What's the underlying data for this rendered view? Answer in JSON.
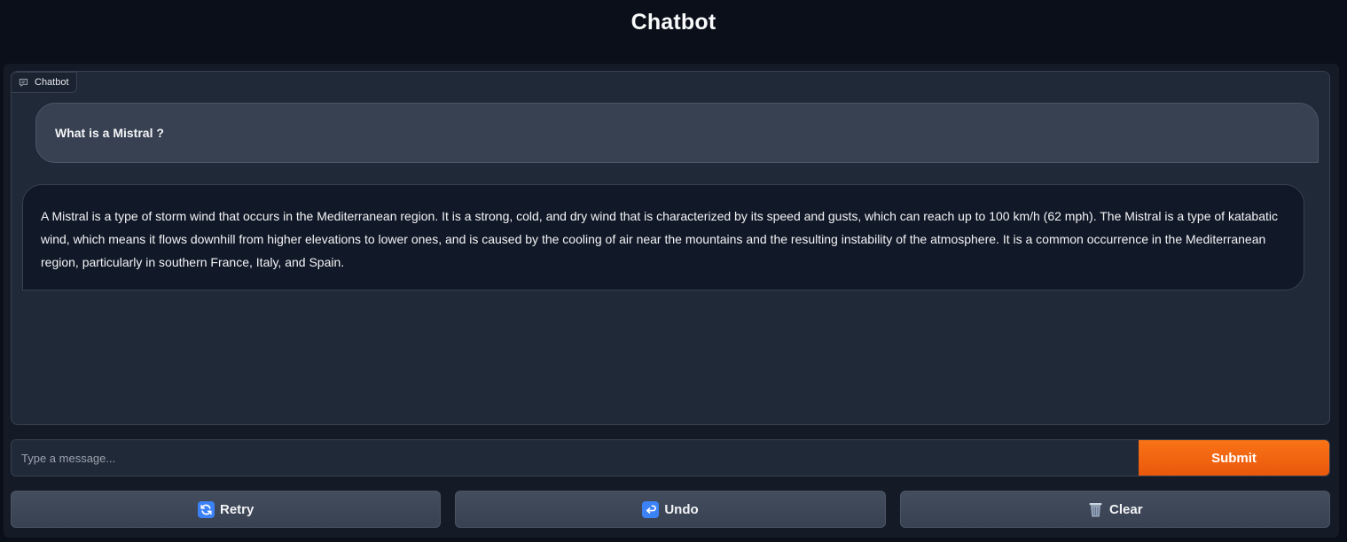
{
  "header": {
    "title": "Chatbot"
  },
  "chatbot": {
    "label": "Chatbot",
    "label_icon": "chat-bubble-icon",
    "messages": [
      {
        "role": "user",
        "text": "What is a Mistral ?"
      },
      {
        "role": "bot",
        "text": "A Mistral is a type of storm wind that occurs in the Mediterranean region. It is a strong, cold, and dry wind that is characterized by its speed and gusts, which can reach up to 100 km/h (62 mph). The Mistral is a type of katabatic wind, which means it flows downhill from higher elevations to lower ones, and is caused by the cooling of air near the mountains and the resulting instability of the atmosphere. It is a common occurrence in the Mediterranean region, particularly in southern France, Italy, and Spain."
      }
    ]
  },
  "input": {
    "placeholder": "Type a message...",
    "value": ""
  },
  "buttons": {
    "submit": "Submit",
    "retry": {
      "label": "Retry",
      "icon": "refresh-icon"
    },
    "undo": {
      "label": "Undo",
      "icon": "return-arrow-icon"
    },
    "clear": {
      "label": "Clear",
      "icon": "wastebasket-icon"
    }
  },
  "colors": {
    "accent": "#f97316",
    "background": "#0b0f19",
    "panel": "#1f2937"
  }
}
